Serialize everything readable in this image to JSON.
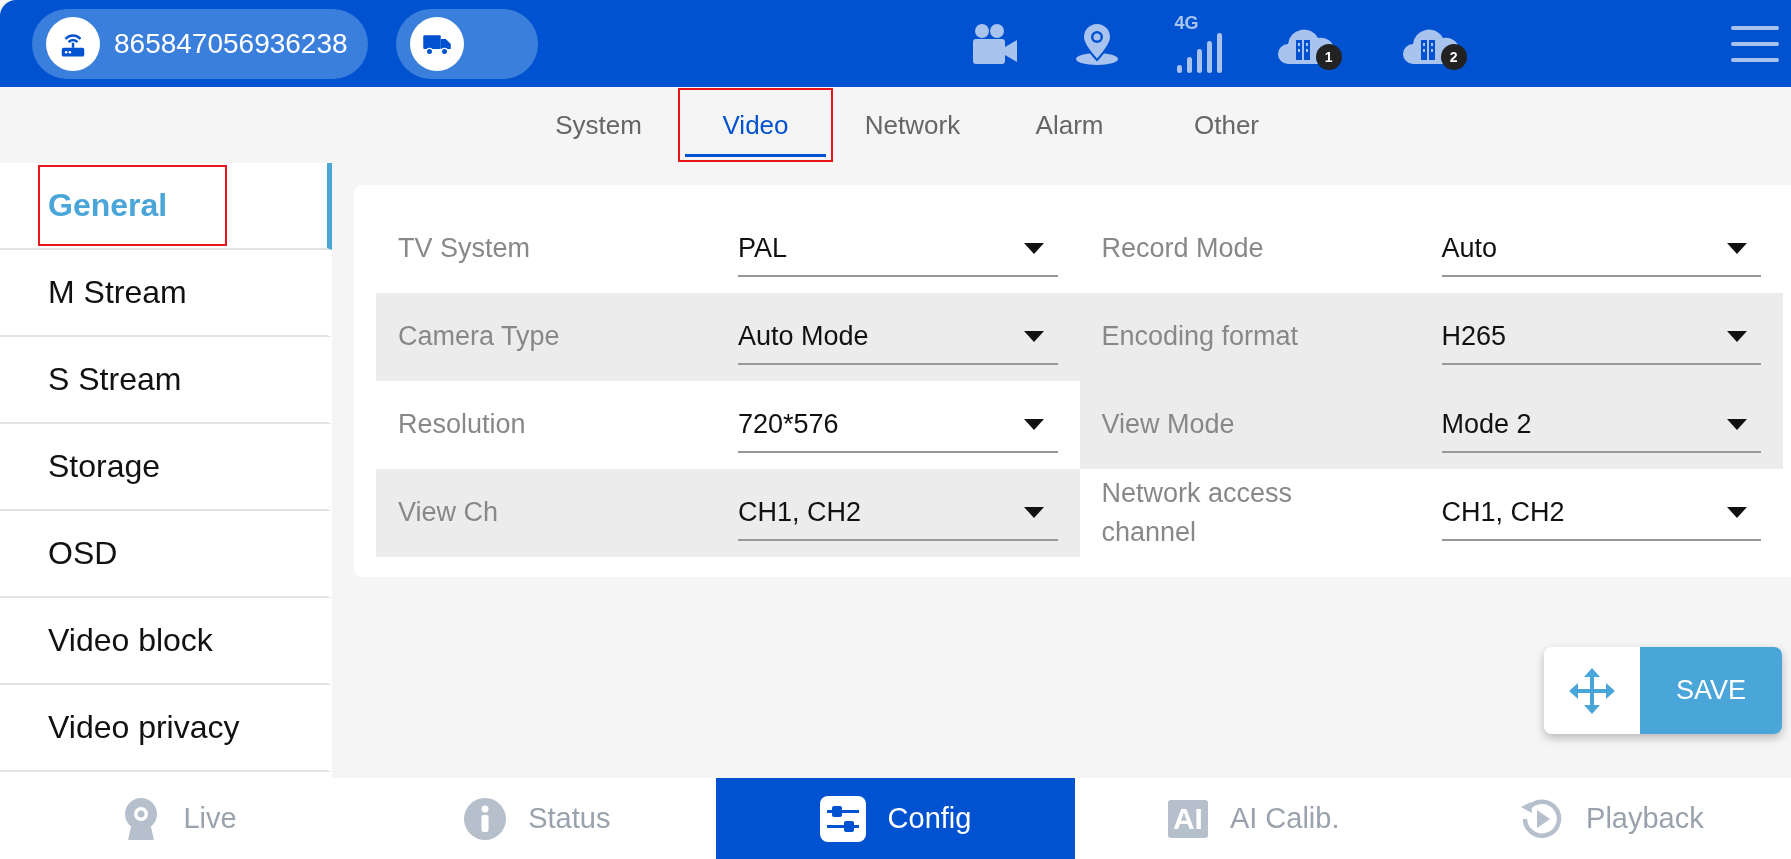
{
  "top_bar": {
    "device_id": "865847056936238",
    "signal_label": "4G",
    "cloud_badges": [
      "1",
      "2"
    ]
  },
  "tabs": [
    {
      "label": "System",
      "selected": false,
      "annotated": false
    },
    {
      "label": "Video",
      "selected": true,
      "annotated": true
    },
    {
      "label": "Network",
      "selected": false,
      "annotated": false
    },
    {
      "label": "Alarm",
      "selected": false,
      "annotated": false
    },
    {
      "label": "Other",
      "selected": false,
      "annotated": false
    }
  ],
  "sidebar": {
    "items": [
      {
        "label": "General",
        "selected": true,
        "annotated": true
      },
      {
        "label": "M Stream",
        "selected": false,
        "annotated": false
      },
      {
        "label": "S Stream",
        "selected": false,
        "annotated": false
      },
      {
        "label": "Storage",
        "selected": false,
        "annotated": false
      },
      {
        "label": "OSD",
        "selected": false,
        "annotated": false
      },
      {
        "label": "Video block",
        "selected": false,
        "annotated": false
      },
      {
        "label": "Video privacy",
        "selected": false,
        "annotated": false
      }
    ]
  },
  "field_rows": [
    {
      "fields": [
        {
          "label": "TV System",
          "value": "PAL",
          "shaded": false
        },
        {
          "label": "Record Mode",
          "value": "Auto",
          "shaded": false
        }
      ]
    },
    {
      "fields": [
        {
          "label": "Camera Type",
          "value": "Auto Mode",
          "shaded": true
        },
        {
          "label": "Encoding format",
          "value": "H265",
          "shaded": true
        }
      ]
    },
    {
      "fields": [
        {
          "label": "Resolution",
          "value": "720*576",
          "shaded": false
        },
        {
          "label": "View Mode",
          "value": "Mode 2",
          "shaded": true
        }
      ]
    },
    {
      "fields": [
        {
          "label": "View Ch",
          "value": "CH1, CH2",
          "shaded": true
        },
        {
          "label": "Network access channel",
          "value": "CH1, CH2",
          "shaded": false
        }
      ]
    }
  ],
  "save_button": {
    "label": "SAVE"
  },
  "bottom_nav": [
    {
      "kind": "live",
      "label": "Live",
      "selected": false
    },
    {
      "kind": "status",
      "label": "Status",
      "selected": false
    },
    {
      "kind": "config",
      "label": "Config",
      "selected": true
    },
    {
      "kind": "ai",
      "label": "AI Calib.",
      "selected": false,
      "icon_text": "AI"
    },
    {
      "kind": "playback",
      "label": "Playback",
      "selected": false
    }
  ]
}
